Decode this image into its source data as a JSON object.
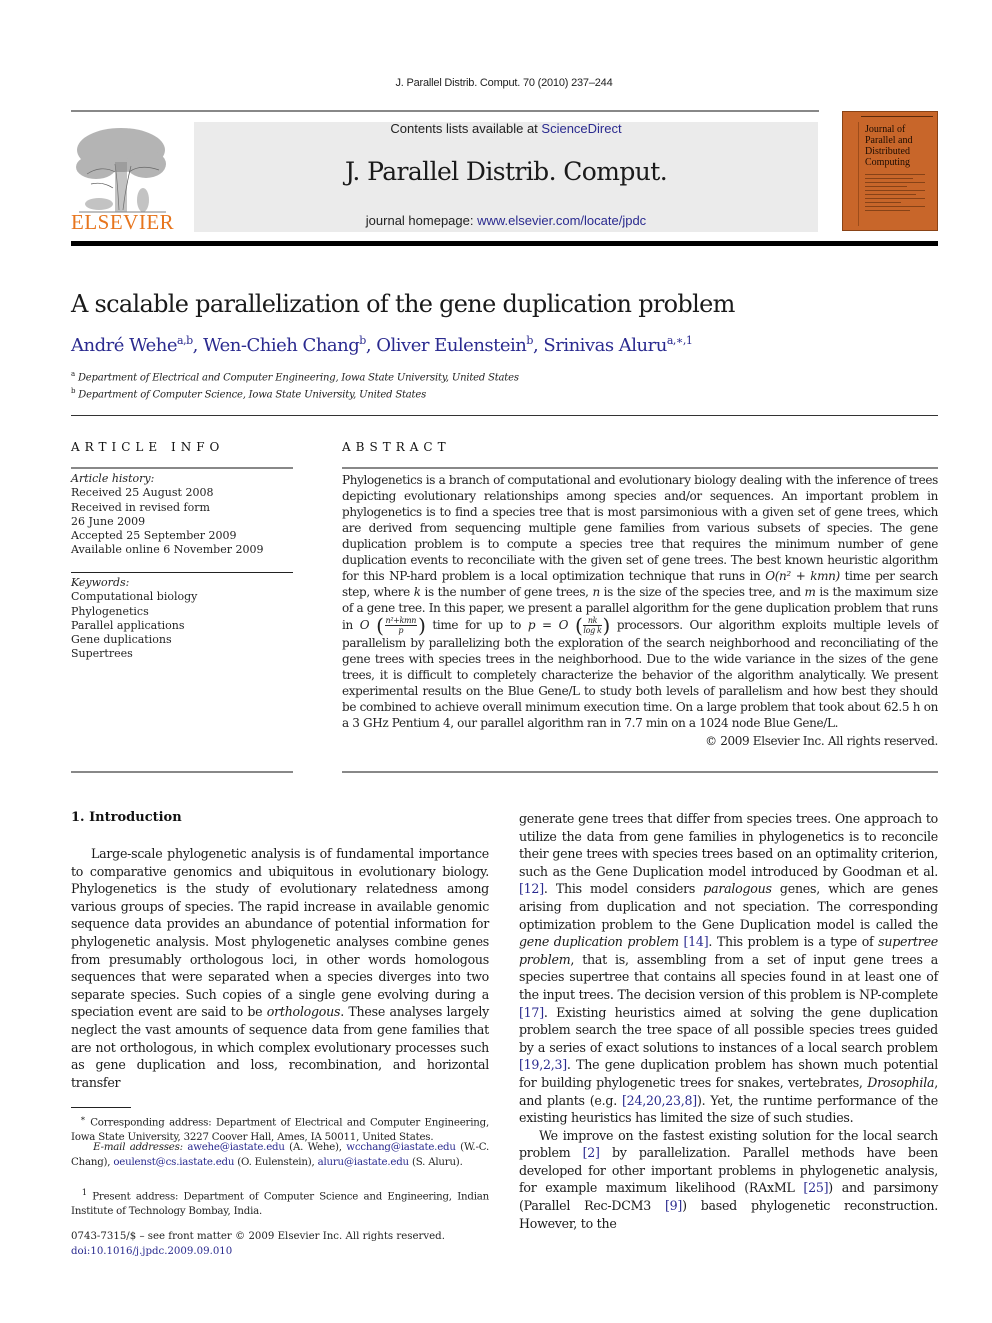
{
  "running_head": "J. Parallel Distrib. Comput. 70 (2010) 237–244",
  "masthead": {
    "contents_prefix": "Contents lists available at ",
    "contents_link": "ScienceDirect",
    "journal_name": "J. Parallel Distrib. Comput.",
    "homepage_prefix": "journal homepage: ",
    "homepage_link": "www.elsevier.com/locate/jpdc",
    "publisher_logo_text": "ELSEVIER",
    "cover_title_lines": [
      "Journal of",
      "Parallel and",
      "Distributed",
      "Computing"
    ],
    "brand_color": "#e7751d",
    "cover_color": "#c8662a"
  },
  "article": {
    "title": "A scalable parallelization of the gene duplication problem",
    "authors": [
      {
        "name": "André Wehe",
        "sup": "a,b"
      },
      {
        "name": "Wen-Chieh Chang",
        "sup": "b"
      },
      {
        "name": "Oliver Eulenstein",
        "sup": "b"
      },
      {
        "name": "Srinivas Aluru",
        "sup": "a,∗,1"
      }
    ],
    "affiliations": [
      {
        "mark": "a",
        "text": "Department of Electrical and Computer Engineering, Iowa State University, United States"
      },
      {
        "mark": "b",
        "text": "Department of Computer Science, Iowa State University, United States"
      }
    ]
  },
  "article_info": {
    "label": "ARTICLE INFO",
    "history_heading": "Article history:",
    "history": [
      "Received 25 August 2008",
      "Received in revised form",
      "26 June 2009",
      "Accepted 25 September 2009",
      "Available online 6 November 2009"
    ],
    "keywords_heading": "Keywords:",
    "keywords": [
      "Computational biology",
      "Phylogenetics",
      "Parallel applications",
      "Gene duplications",
      "Supertrees"
    ]
  },
  "abstract": {
    "label": "ABSTRACT",
    "part1": "Phylogenetics is a branch of computational and evolutionary biology dealing with the inference of trees depicting evolutionary relationships among species and/or sequences. An important problem in phylogenetics is to find a species tree that is most parsimonious with a given set of gene trees, which are derived from sequencing multiple gene families from various subsets of species. The gene duplication problem is to compute a species tree that requires the minimum number of gene duplication events to reconciliate with the given set of gene trees. The best known heuristic algorithm for this NP-hard problem is a local optimization technique that runs in ",
    "math1": "O(n² + kmn)",
    "part2": " time per search step, where ",
    "var_k": "k",
    "part3": " is the number of gene trees, ",
    "var_n": "n",
    "part4": " is the size of the species tree, and ",
    "var_m": "m",
    "part5": " is the maximum size of a gene tree. In this paper, we present a parallel algorithm for the gene duplication problem that runs in ",
    "math2_O": "O",
    "math2_num": "n²+kmn",
    "math2_den": "p",
    "part6": " time for up to ",
    "math3_lhs": "p = O",
    "math3_num": "nk",
    "math3_den": "log k",
    "part7": " processors. Our algorithm exploits multiple levels of parallelism by parallelizing both the exploration of the search neighborhood and reconciliating of the gene trees with species trees in the neighborhood. Due to the wide variance in the sizes of the gene trees, it is difficult to completely characterize the behavior of the algorithm analytically. We present experimental results on the Blue Gene/L to study both levels of parallelism and how best they should be combined to achieve overall minimum execution time. On a large problem that took about 62.5 h on a 3 GHz Pentium 4, our parallel algorithm ran in 7.7 min on a 1024 node Blue Gene/L.",
    "copyright": "© 2009 Elsevier Inc. All rights reserved."
  },
  "introduction": {
    "heading": "1.  Introduction",
    "left_p1_a": "Large-scale phylogenetic analysis is of fundamental importance to comparative genomics and ubiquitous in evolutionary biology. Phylogenetics is the study of evolutionary relatedness among various groups of species. The rapid increase in available genomic sequence data provides an abundance of potential information for phylogenetic analysis. Most phylogenetic analyses combine genes from presumably orthologous loci, in other words homologous sequences that were separated when a species diverges into two separate species. Such copies of a single gene evolving during a speciation event are said to be ",
    "left_p1_em": "orthologous",
    "left_p1_b": ". These analyses largely neglect the vast amounts of sequence data from gene families that are not orthologous, in which complex evolutionary processes such as gene duplication and loss, recombination, and horizontal transfer",
    "right_p1_a": "generate gene trees that differ from species trees. One approach to utilize the data from gene families in phylogenetics is to reconcile their gene trees with species trees based on an optimality criterion, such as the Gene Duplication model introduced by Goodman et al. ",
    "ref_12": "[12]",
    "right_p1_b": ". This model considers ",
    "em_paralogous": "paralogous",
    "right_p1_c": " genes, which are genes arising from duplication and not speciation. The corresponding optimization problem to the Gene Duplication model is called the ",
    "em_gdp": "gene duplication problem",
    "right_p1_d": " ",
    "ref_14": "[14]",
    "right_p1_e": ". This problem is a type of ",
    "em_supertree": "supertree problem",
    "right_p1_f": ", that is, assembling from a set of input gene trees a species supertree that contains all species found in at least one of the input trees. The decision version of this problem is NP-complete ",
    "ref_17": "[17]",
    "right_p1_g": ". Existing heuristics aimed at solving the gene duplication problem search the tree space of all possible species trees guided by a series of exact solutions to instances of a local search problem ",
    "ref_19_2_3": "[19,2,3]",
    "right_p1_h": ". The gene duplication problem has shown much potential for building phylogenetic trees for snakes, vertebrates, ",
    "em_drosophila": "Drosophila",
    "right_p1_i": ", and plants (e.g. ",
    "ref_24_20_23_8": "[24,20,23,8]",
    "right_p1_j": "). Yet, the runtime performance of the existing heuristics has limited the size of such studies.",
    "right_p2_a": "We improve on the fastest existing solution for the local search problem ",
    "ref_2": "[2]",
    "right_p2_b": " by parallelization. Parallel methods have been developed for other important problems in phylogenetic analysis, for example maximum likelihood (RAxML ",
    "ref_25": "[25]",
    "right_p2_c": ") and parsimony (Parallel Rec-DCM3 ",
    "ref_9": "[9]",
    "right_p2_d": ") based phylogenetic reconstruction. However, to the"
  },
  "footnotes": {
    "corr_mark": "∗",
    "corr_text": "Corresponding address: Department of Electrical and Computer Engineering, Iowa State University, 3227 Coover Hall, Ames, IA 50011, United States.",
    "emails_label": "E-mail addresses:",
    "emails": [
      {
        "addr": "awehe@iastate.edu",
        "who": "(A. Wehe),"
      },
      {
        "addr": "wcchang@iastate.edu",
        "who": "(W.-C. Chang),"
      },
      {
        "addr": "oeulenst@cs.iastate.edu",
        "who": "(O. Eulenstein),"
      },
      {
        "addr": "aluru@iastate.edu",
        "who": "(S. Aluru)."
      }
    ],
    "present_mark": "1",
    "present_text": "Present address: Department of Computer Science and Engineering, Indian Institute of Technology Bombay, India."
  },
  "front_matter": {
    "issn_line": "0743-7315/$ – see front matter © 2009 Elsevier Inc. All rights reserved.",
    "doi": "doi:10.1016/j.jpdc.2009.09.010"
  }
}
